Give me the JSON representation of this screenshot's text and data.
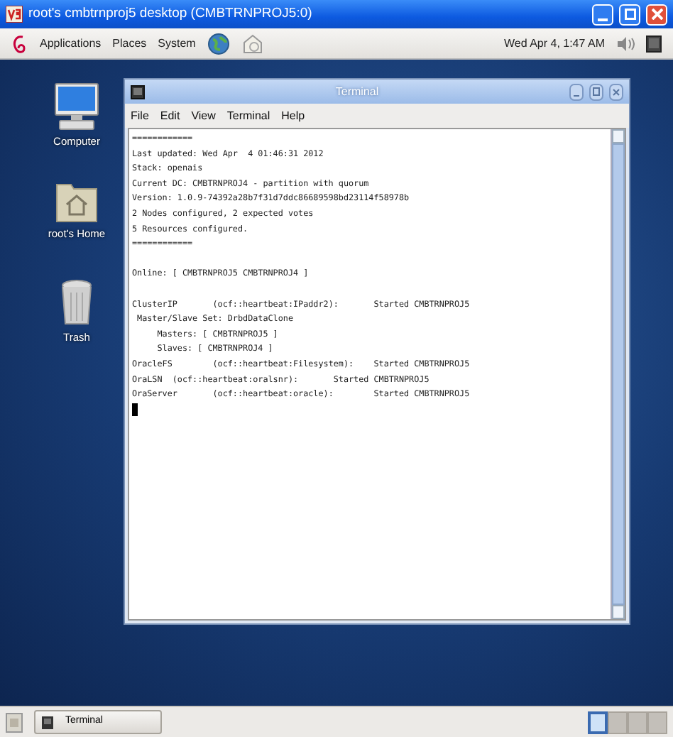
{
  "window": {
    "title": "root's cmbtrnproj5 desktop (CMBTRNPROJ5:0)"
  },
  "top_panel": {
    "menus": [
      "Applications",
      "Places",
      "System"
    ],
    "clock": "Wed Apr  4,  1:47 AM"
  },
  "desktop_icons": [
    {
      "label": "Computer",
      "kind": "computer"
    },
    {
      "label": "root's Home",
      "kind": "home"
    },
    {
      "label": "Trash",
      "kind": "trash"
    }
  ],
  "terminal": {
    "title": "Terminal",
    "menus": [
      "File",
      "Edit",
      "View",
      "Terminal",
      "Help"
    ],
    "cursor_visible": true,
    "blocks": [
      [
        "============",
        "Last updated: Wed Apr  4 01:46:31 2012",
        "Stack: openais",
        "Current DC: CMBTRNPROJ4 - partition with quorum",
        "Version: 1.0.9-74392a28b7f31d7ddc86689598bd23114f58978b",
        "2 Nodes configured, 2 expected votes",
        "5 Resources configured.",
        "============"
      ],
      [
        "Online: [ CMBTRNPROJ5 CMBTRNPROJ4 ]"
      ],
      [
        "ClusterIP\t(ocf::heartbeat:IPaddr2):\tStarted CMBTRNPROJ5",
        " Master/Slave Set: DrbdDataClone",
        "     Masters: [ CMBTRNPROJ5 ]",
        "     Slaves: [ CMBTRNPROJ4 ]",
        "OracleFS\t(ocf::heartbeat:Filesystem):\tStarted CMBTRNPROJ5",
        "OraLSN\t(ocf::heartbeat:oralsnr):\tStarted CMBTRNPROJ5",
        "OraServer\t(ocf::heartbeat:oracle):\tStarted CMBTRNPROJ5"
      ]
    ]
  },
  "taskbar": {
    "tasks": [
      {
        "label": "Terminal"
      }
    ],
    "workspaces": [
      {
        "selected": true
      },
      {
        "selected": false
      },
      {
        "selected": false
      },
      {
        "selected": false
      }
    ]
  }
}
